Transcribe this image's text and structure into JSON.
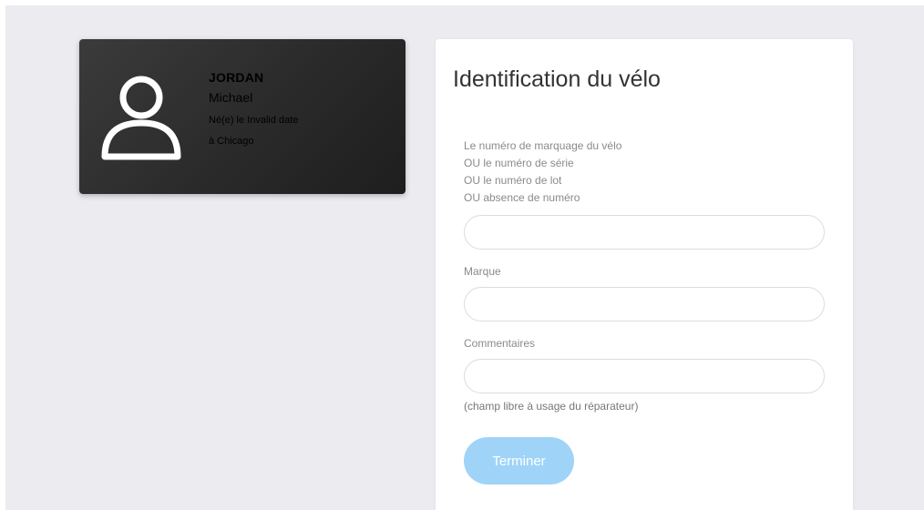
{
  "owner": {
    "last_name": "JORDAN",
    "first_name": "Michael",
    "birth_line": "Né(e) le Invalid date",
    "place_line": "à Chicago",
    "avatar_icon": "user-icon"
  },
  "form": {
    "title": "Identification du vélo",
    "number_label_lines": [
      "Le numéro de marquage du vélo",
      "OU le numéro de série",
      "OU le numéro de lot",
      "OU absence de numéro"
    ],
    "number_value": "",
    "brand_label": "Marque",
    "brand_value": "",
    "comments_label": "Commentaires",
    "comments_value": "",
    "comments_help": "(champ libre à usage du réparateur)",
    "finish_label": "Terminer"
  },
  "colors": {
    "background": "#ebebf0",
    "card_dark": "#2a2a2a",
    "button": "#9fd4f8"
  }
}
